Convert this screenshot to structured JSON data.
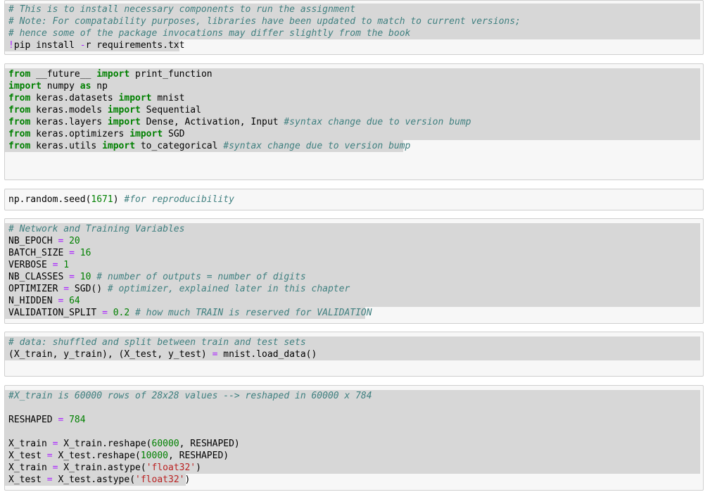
{
  "selection_color": "#d7d7d7",
  "cells": [
    {
      "lines": [
        [
          {
            "t": "cm",
            "v": "# This is to install necessary components to run the assignment"
          }
        ],
        [
          {
            "t": "cm",
            "v": "# Note: For compatability purposes, libraries have been updated to match to current versions;"
          }
        ],
        [
          {
            "t": "cm",
            "v": "# hence some of the package invocations may differ slightly from the book"
          }
        ],
        [
          {
            "t": "bang",
            "v": "!"
          },
          {
            "t": "",
            "v": "pip install "
          },
          {
            "t": "op",
            "v": "-"
          },
          {
            "t": "",
            "v": "r requirements.txt"
          }
        ]
      ]
    },
    {
      "lines": [
        [
          {
            "t": "kw",
            "v": "from"
          },
          {
            "t": "",
            "v": " __future__ "
          },
          {
            "t": "kw",
            "v": "import"
          },
          {
            "t": "",
            "v": " print_function"
          }
        ],
        [
          {
            "t": "kw",
            "v": "import"
          },
          {
            "t": "",
            "v": " numpy "
          },
          {
            "t": "kw",
            "v": "as"
          },
          {
            "t": "",
            "v": " np"
          }
        ],
        [
          {
            "t": "kw",
            "v": "from"
          },
          {
            "t": "",
            "v": " keras.datasets "
          },
          {
            "t": "kw",
            "v": "import"
          },
          {
            "t": "",
            "v": " mnist"
          }
        ],
        [
          {
            "t": "kw",
            "v": "from"
          },
          {
            "t": "",
            "v": " keras.models "
          },
          {
            "t": "kw",
            "v": "import"
          },
          {
            "t": "",
            "v": " Sequential"
          }
        ],
        [
          {
            "t": "kw",
            "v": "from"
          },
          {
            "t": "",
            "v": " keras.layers "
          },
          {
            "t": "kw",
            "v": "import"
          },
          {
            "t": "",
            "v": " Dense, Activation, Input "
          },
          {
            "t": "cm",
            "v": "#syntax change due to version bump"
          }
        ],
        [
          {
            "t": "kw",
            "v": "from"
          },
          {
            "t": "",
            "v": " keras.optimizers "
          },
          {
            "t": "kw",
            "v": "import"
          },
          {
            "t": "",
            "v": " SGD"
          }
        ],
        [
          {
            "t": "kw",
            "v": "from"
          },
          {
            "t": "",
            "v": " keras.utils "
          },
          {
            "t": "kw",
            "v": "import"
          },
          {
            "t": "",
            "v": " to_categorical "
          },
          {
            "t": "cm",
            "v": "#syntax change due to version bump"
          }
        ]
      ]
    },
    {
      "lines": [
        [
          {
            "t": "",
            "v": "np.random.seed("
          },
          {
            "t": "nm",
            "v": "1671"
          },
          {
            "t": "",
            "v": ") "
          },
          {
            "t": "cm",
            "v": "#for reproducibility"
          }
        ]
      ]
    },
    {
      "lines": [
        [
          {
            "t": "cm",
            "v": "# Network and Training Variables"
          }
        ],
        [
          {
            "t": "",
            "v": "NB_EPOCH "
          },
          {
            "t": "op",
            "v": "="
          },
          {
            "t": "",
            "v": " "
          },
          {
            "t": "nm",
            "v": "20"
          }
        ],
        [
          {
            "t": "",
            "v": "BATCH_SIZE "
          },
          {
            "t": "op",
            "v": "="
          },
          {
            "t": "",
            "v": " "
          },
          {
            "t": "nm",
            "v": "16"
          }
        ],
        [
          {
            "t": "",
            "v": "VERBOSE "
          },
          {
            "t": "op",
            "v": "="
          },
          {
            "t": "",
            "v": " "
          },
          {
            "t": "nm",
            "v": "1"
          }
        ],
        [
          {
            "t": "",
            "v": "NB_CLASSES "
          },
          {
            "t": "op",
            "v": "="
          },
          {
            "t": "",
            "v": " "
          },
          {
            "t": "nm",
            "v": "10"
          },
          {
            "t": "",
            "v": " "
          },
          {
            "t": "cm",
            "v": "# number of outputs = number of digits"
          }
        ],
        [
          {
            "t": "",
            "v": "OPTIMIZER "
          },
          {
            "t": "op",
            "v": "="
          },
          {
            "t": "",
            "v": " SGD() "
          },
          {
            "t": "cm",
            "v": "# optimizer, explained later in this chapter"
          }
        ],
        [
          {
            "t": "",
            "v": "N_HIDDEN "
          },
          {
            "t": "op",
            "v": "="
          },
          {
            "t": "",
            "v": " "
          },
          {
            "t": "nm",
            "v": "64"
          }
        ],
        [
          {
            "t": "",
            "v": "VALIDATION_SPLIT "
          },
          {
            "t": "op",
            "v": "="
          },
          {
            "t": "",
            "v": " "
          },
          {
            "t": "nm",
            "v": "0.2"
          },
          {
            "t": "",
            "v": " "
          },
          {
            "t": "cm",
            "v": "# how much TRAIN is reserved for VALIDATION"
          }
        ]
      ]
    },
    {
      "lines": [
        [
          {
            "t": "cm",
            "v": "# data: shuffled and split between train and test sets"
          }
        ],
        [
          {
            "t": "",
            "v": "(X_train, y_train), (X_test, y_test) "
          },
          {
            "t": "op",
            "v": "="
          },
          {
            "t": "",
            "v": " mnist.load_data()"
          }
        ]
      ]
    },
    {
      "lines": [
        [
          {
            "t": "cm",
            "v": "#X_train is 60000 rows of 28x28 values --> reshaped in 60000 x 784"
          }
        ],
        [
          {
            "t": "",
            "v": ""
          }
        ],
        [
          {
            "t": "",
            "v": "RESHAPED "
          },
          {
            "t": "op",
            "v": "="
          },
          {
            "t": "",
            "v": " "
          },
          {
            "t": "nm",
            "v": "784"
          }
        ],
        [
          {
            "t": "",
            "v": ""
          }
        ],
        [
          {
            "t": "",
            "v": "X_train "
          },
          {
            "t": "op",
            "v": "="
          },
          {
            "t": "",
            "v": " X_train.reshape("
          },
          {
            "t": "nm",
            "v": "60000"
          },
          {
            "t": "",
            "v": ", RESHAPED)"
          }
        ],
        [
          {
            "t": "",
            "v": "X_test "
          },
          {
            "t": "op",
            "v": "="
          },
          {
            "t": "",
            "v": " X_test.reshape("
          },
          {
            "t": "nm",
            "v": "10000"
          },
          {
            "t": "",
            "v": ", RESHAPED)"
          }
        ],
        [
          {
            "t": "",
            "v": "X_train "
          },
          {
            "t": "op",
            "v": "="
          },
          {
            "t": "",
            "v": " X_train.astype("
          },
          {
            "t": "st",
            "v": "'float32'"
          },
          {
            "t": "",
            "v": ")"
          }
        ],
        [
          {
            "t": "",
            "v": "X_test "
          },
          {
            "t": "op",
            "v": "="
          },
          {
            "t": "",
            "v": " X_test.astype("
          },
          {
            "t": "st",
            "v": "'float32'"
          },
          {
            "t": "",
            "v": ")"
          }
        ]
      ]
    }
  ]
}
